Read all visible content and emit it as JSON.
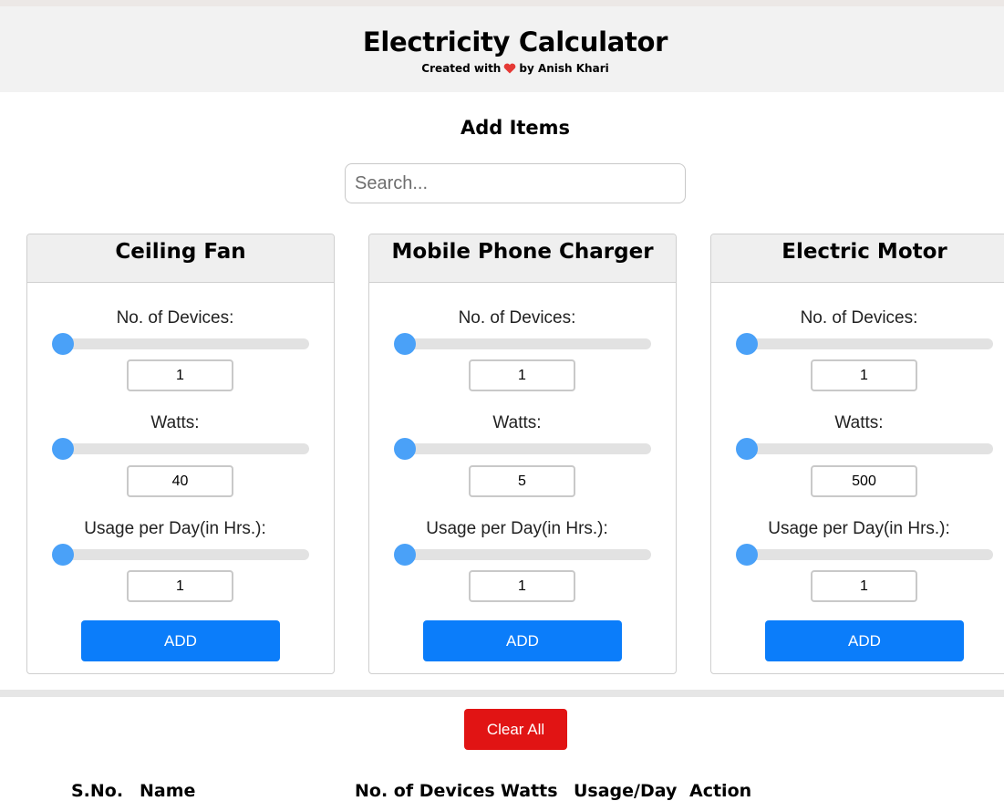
{
  "header": {
    "title": "Electricity Calculator",
    "subtitle_prefix": "Created with",
    "subtitle_suffix": "by Anish Khari",
    "heart_icon": "heart-icon",
    "heart_color": "#e53935"
  },
  "add_items": {
    "title": "Add Items",
    "search_placeholder": "Search...",
    "search_value": ""
  },
  "labels": {
    "devices": "No. of Devices:",
    "watts": "Watts:",
    "usage": "Usage per Day(in Hrs.):",
    "add": "ADD"
  },
  "items": [
    {
      "name": "Ceiling Fan",
      "devices": "1",
      "watts": "40",
      "usage": "1"
    },
    {
      "name": "Mobile Phone Charger",
      "devices": "1",
      "watts": "5",
      "usage": "1"
    },
    {
      "name": "Electric Motor",
      "devices": "1",
      "watts": "500",
      "usage": "1"
    }
  ],
  "clear_all_label": "Clear All",
  "table": {
    "headers": [
      "S.No.",
      "Name",
      "No. of Devices",
      "Watts",
      "Usage/Day",
      "Action"
    ]
  },
  "colors": {
    "accent": "#0b7dfa",
    "slider_thumb": "#4aa1f8",
    "danger": "#e11414",
    "header_bg": "#f2f2f2"
  }
}
